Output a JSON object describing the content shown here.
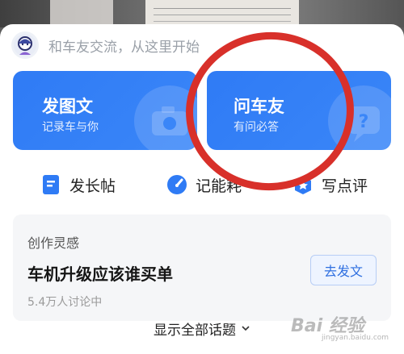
{
  "compose": {
    "placeholder": "和车友交流，从这里开始",
    "avatar_icon": "user-avatar-icon"
  },
  "cards": [
    {
      "title": "发图文",
      "subtitle": "记录车与你",
      "icon": "camera-icon",
      "color": "#2f7bf5"
    },
    {
      "title": "问车友",
      "subtitle": "有问必答",
      "icon": "question-icon",
      "color": "#2f7bf5"
    }
  ],
  "quick_actions": [
    {
      "label": "发长帖",
      "icon": "document-icon"
    },
    {
      "label": "记能耗",
      "icon": "gauge-icon"
    },
    {
      "label": "写点评",
      "icon": "rating-icon"
    }
  ],
  "inspiration": {
    "title": "创作灵感",
    "topic": "车机升级应该谁买单",
    "meta": "5.4万人讨论中",
    "button": "去发文"
  },
  "footer": {
    "show_all": "显示全部话题",
    "chevron_icon": "chevron-down-icon"
  },
  "watermark": {
    "text": "Bai 经验",
    "sub": "jingyan.baidu.com"
  },
  "colors": {
    "accent": "#2f7bf5",
    "annotation_ring": "#d8302a"
  }
}
